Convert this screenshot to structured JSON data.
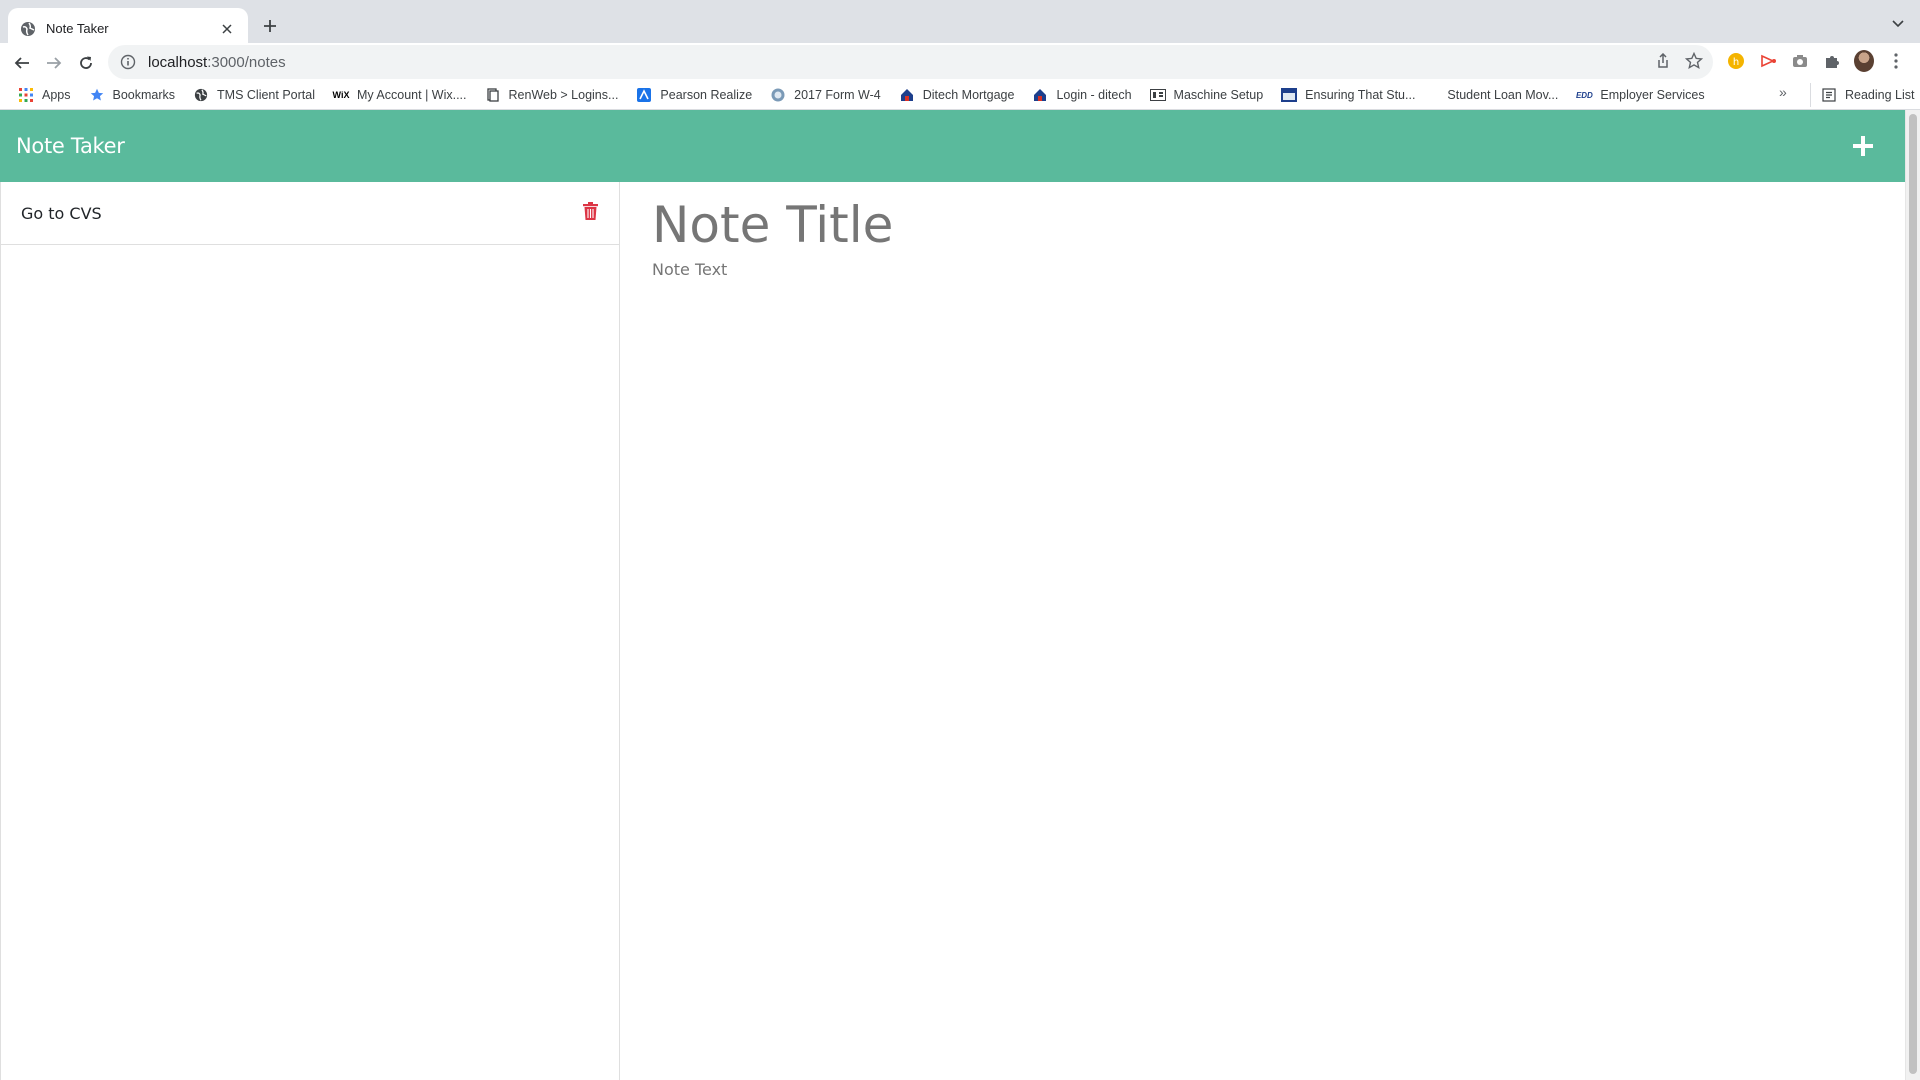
{
  "browser": {
    "tab_title": "Note Taker",
    "url_host": "localhost",
    "url_path": ":3000/notes",
    "bookmarks": [
      {
        "label": "Apps",
        "icon": "apps-grid-icon"
      },
      {
        "label": "Bookmarks",
        "icon": "star-icon"
      },
      {
        "label": "TMS Client Portal",
        "icon": "globe-icon"
      },
      {
        "label": "My Account | Wix....",
        "icon": "wix-icon"
      },
      {
        "label": "RenWeb > Logins...",
        "icon": "page-icon"
      },
      {
        "label": "Pearson Realize",
        "icon": "pearson-icon"
      },
      {
        "label": "2017 Form W-4",
        "icon": "irs-icon"
      },
      {
        "label": "Ditech Mortgage",
        "icon": "house-icon"
      },
      {
        "label": "Login - ditech",
        "icon": "house-icon"
      },
      {
        "label": "Maschine Setup",
        "icon": "device-icon"
      },
      {
        "label": "Ensuring That Stu...",
        "icon": "doc-icon"
      },
      {
        "label": "Student Loan Mov...",
        "icon": "blank-icon"
      },
      {
        "label": "Employer Services",
        "icon": "edd-icon"
      }
    ],
    "reading_list": "Reading List"
  },
  "app": {
    "title": "Note Taker",
    "accent_color": "#5aba9c",
    "notes": [
      {
        "title": "Go to CVS"
      }
    ],
    "editor": {
      "title_placeholder": "Note Title",
      "text_placeholder": "Note Text"
    }
  }
}
